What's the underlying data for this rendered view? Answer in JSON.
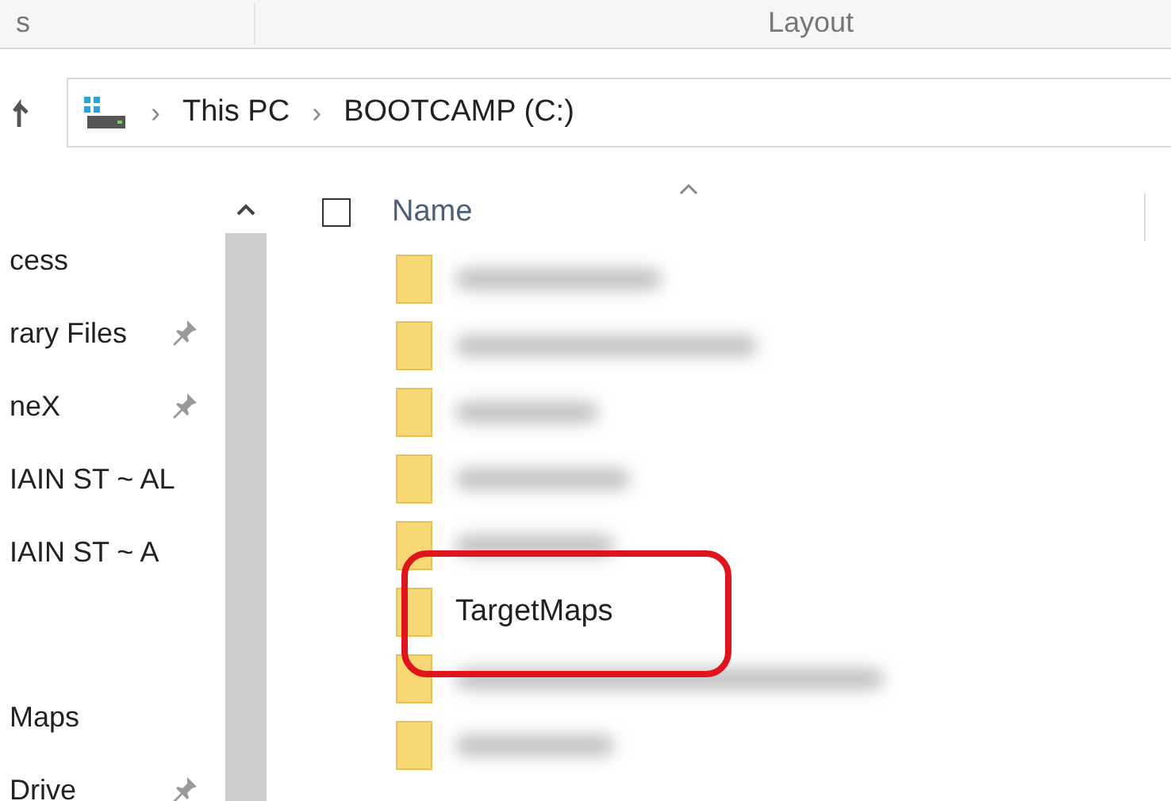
{
  "ribbon": {
    "tabs": [
      {
        "label": "s"
      },
      {
        "label": "Layout"
      }
    ]
  },
  "address_bar": {
    "crumbs": [
      "This PC",
      "BOOTCAMP (C:)"
    ],
    "separator": "›"
  },
  "navigation_pane": {
    "items": [
      {
        "label": "cess",
        "pinned": false
      },
      {
        "label": "rary Files",
        "pinned": true
      },
      {
        "label": "neX",
        "pinned": true
      },
      {
        "label": "IAIN ST ~ AL",
        "pinned": false
      },
      {
        "label": "IAIN ST ~ A",
        "pinned": false
      },
      {
        "label": "Maps",
        "pinned": false,
        "group_start": true
      },
      {
        "label": "Drive",
        "pinned": true
      }
    ]
  },
  "file_list": {
    "column_header": "Name",
    "select_all_checked": false,
    "rows": [
      {
        "blurred": true
      },
      {
        "blurred": true
      },
      {
        "blurred": true
      },
      {
        "blurred": true
      },
      {
        "blurred": true
      },
      {
        "blurred": false,
        "name": "TargetMaps",
        "highlighted": true
      },
      {
        "blurred": true
      },
      {
        "blurred": true
      }
    ]
  }
}
